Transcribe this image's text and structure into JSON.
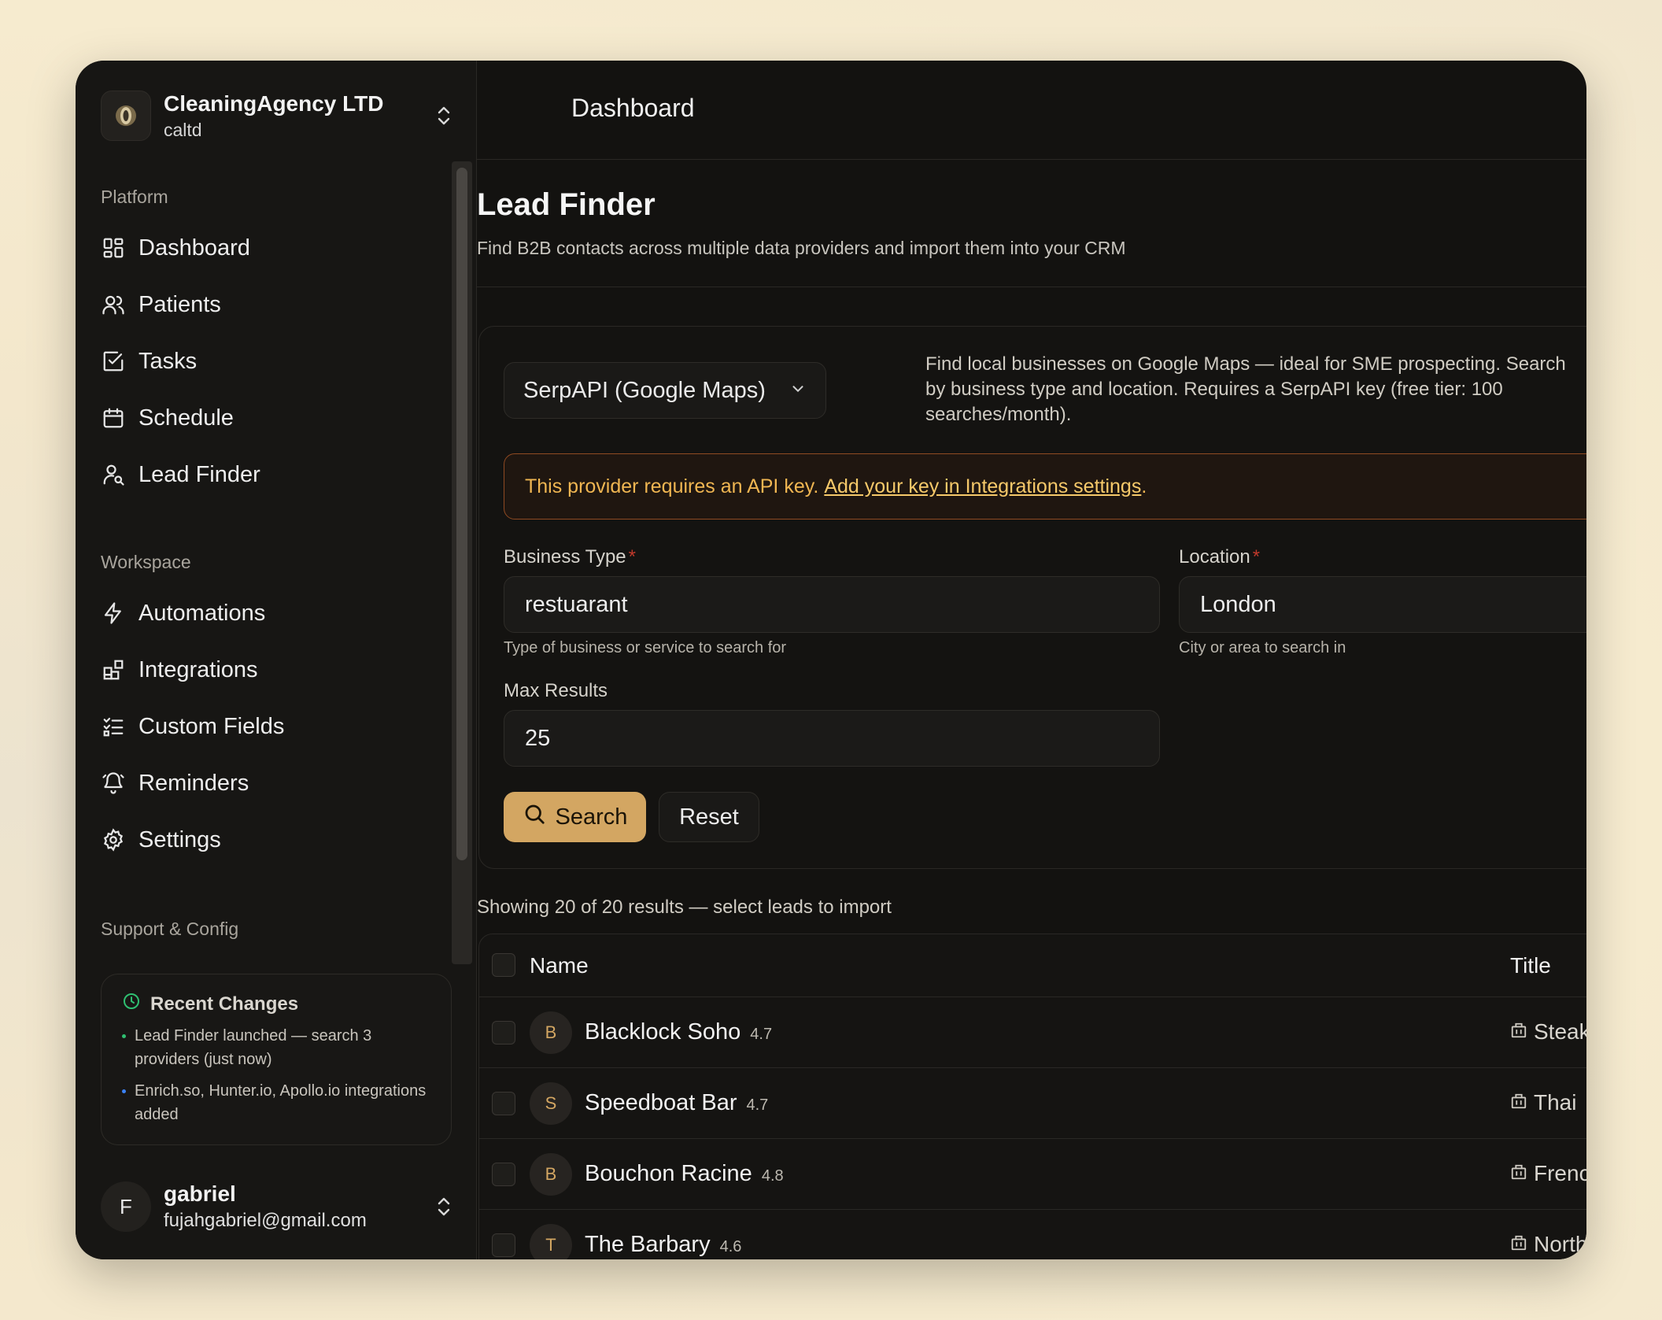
{
  "org": {
    "name": "CleaningAgency LTD",
    "sub": "caltd"
  },
  "sidebar": {
    "platform_label": "Platform",
    "platform_items": [
      {
        "label": "Dashboard",
        "icon": "dashboard-icon"
      },
      {
        "label": "Patients",
        "icon": "users-icon"
      },
      {
        "label": "Tasks",
        "icon": "checkbox-icon"
      },
      {
        "label": "Schedule",
        "icon": "calendar-icon"
      },
      {
        "label": "Lead Finder",
        "icon": "user-search-icon"
      }
    ],
    "workspace_label": "Workspace",
    "workspace_items": [
      {
        "label": "Automations",
        "icon": "bolt-icon"
      },
      {
        "label": "Integrations",
        "icon": "blocks-icon"
      },
      {
        "label": "Custom Fields",
        "icon": "list-checks-icon"
      },
      {
        "label": "Reminders",
        "icon": "bell-icon"
      },
      {
        "label": "Settings",
        "icon": "gear-icon"
      }
    ],
    "support_label": "Support & Config",
    "recent_changes": {
      "title": "Recent Changes",
      "items": [
        {
          "text": "Lead Finder launched — search 3 providers (just now)",
          "dot_color": "#2fbf71"
        },
        {
          "text": "Enrich.so, Hunter.io, Apollo.io integrations added",
          "dot_color": "#3b82f6"
        }
      ]
    },
    "user": {
      "initial": "F",
      "name": "gabriel",
      "email": "fujahgabriel@gmail.com"
    }
  },
  "topbar": {
    "title": "Dashboard"
  },
  "page": {
    "title": "Lead Finder",
    "subtitle": "Find B2B contacts across multiple data providers and import them into your CRM"
  },
  "provider": {
    "selected": "SerpAPI (Google Maps)",
    "description_lines": [
      "Find local businesses on Google Maps — ideal for SME prospecting. Search",
      "by business type and location. Requires a SerpAPI key (free tier: 100",
      "searches/month)."
    ]
  },
  "alert": {
    "text": "This provider requires an API key.",
    "link": "Add your key in Integrations settings",
    "suffix": "."
  },
  "form": {
    "business_type": {
      "label": "Business Type",
      "value": "restuarant",
      "hint": "Type of business or service to search for"
    },
    "location": {
      "label": "Location",
      "value": "London",
      "hint": "City or area to search in"
    },
    "max_results": {
      "label": "Max Results",
      "value": "25"
    },
    "required_mark": "*",
    "search_label": "Search",
    "reset_label": "Reset"
  },
  "results": {
    "note": "Showing 20 of 20 results — select leads to import",
    "columns": {
      "name": "Name",
      "title": "Title"
    },
    "rows": [
      {
        "initial": "B",
        "name": "Blacklock Soho",
        "rating": "4.7",
        "title": "Steak"
      },
      {
        "initial": "S",
        "name": "Speedboat Bar",
        "rating": "4.7",
        "title": "Thai"
      },
      {
        "initial": "B",
        "name": "Bouchon Racine",
        "rating": "4.8",
        "title": "French"
      },
      {
        "initial": "T",
        "name": "The Barbary",
        "rating": "4.6",
        "title": "North"
      }
    ]
  },
  "colors": {
    "accent": "#d3a662",
    "alert_border": "#8f4a22",
    "alert_text": "#f0b652",
    "background": "#131210"
  }
}
